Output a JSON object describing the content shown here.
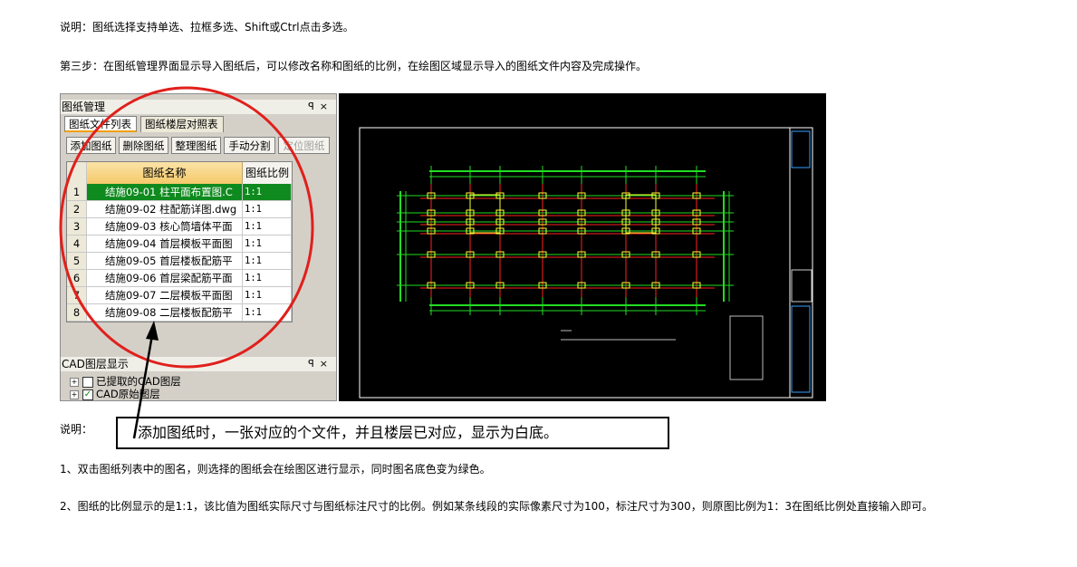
{
  "doc": {
    "line1": "说明：图纸选择支持单选、拉框多选、Shift或Ctrl点击多选。",
    "line2": "第三步：在图纸管理界面显示导入图纸后，可以修改名称和图纸的比例，在绘图区域显示导入的图纸文件内容及完成操作。",
    "note_label": "说明：",
    "note_box": "添加图纸时，一张对应的个文件，并且楼层已对应，显示为白底。",
    "para1": "1、双击图纸列表中的图名，则选择的图纸会在绘图区进行显示，同时图名底色变为绿色。",
    "para2": "2、图纸的比例显示的是1:1，该比值为图纸实际尺寸与图纸标注尺寸的比例。例如某条线段的实际像素尺寸为100，标注尺寸为300，则原图比例为1：3在图纸比例处直接输入即可。"
  },
  "panel": {
    "title": "图纸管理",
    "pin_icon": "pin-icon",
    "close_icon": "close-icon",
    "tabs": [
      "图纸文件列表",
      "图纸楼层对照表"
    ],
    "toolbar": [
      "添加图纸",
      "删除图纸",
      "整理图纸",
      "手动分割",
      "定位图纸"
    ],
    "columns": [
      "图纸名称",
      "图纸比例"
    ],
    "rows": [
      {
        "num": "1",
        "name": "结施09-01 柱平面布置图.C",
        "scale": "1:1"
      },
      {
        "num": "2",
        "name": "结施09-02 柱配筋详图.dwg",
        "scale": "1:1"
      },
      {
        "num": "3",
        "name": "结施09-03 核心筒墙体平面",
        "scale": "1:1"
      },
      {
        "num": "4",
        "name": "结施09-04 首层模板平面图",
        "scale": "1:1"
      },
      {
        "num": "5",
        "name": "结施09-05 首层楼板配筋平",
        "scale": "1:1"
      },
      {
        "num": "6",
        "name": "结施09-06 首层梁配筋平面",
        "scale": "1:1"
      },
      {
        "num": "7",
        "name": "结施09-07 二层模板平面图",
        "scale": "1:1"
      },
      {
        "num": "8",
        "name": "结施09-08 二层楼板配筋平",
        "scale": "1:1"
      }
    ],
    "selected_row_color": "#0f8a1e"
  },
  "layers": {
    "title": "CAD图层显示",
    "items": [
      {
        "label": "已提取的CAD图层",
        "checked": false
      },
      {
        "label": "CAD原始图层",
        "checked": true
      }
    ]
  },
  "colors": {
    "annotation_circle": "#e0201c",
    "canvas_bg": "#000000",
    "cad_green": "#22dd22",
    "cad_red": "#ff2020"
  }
}
